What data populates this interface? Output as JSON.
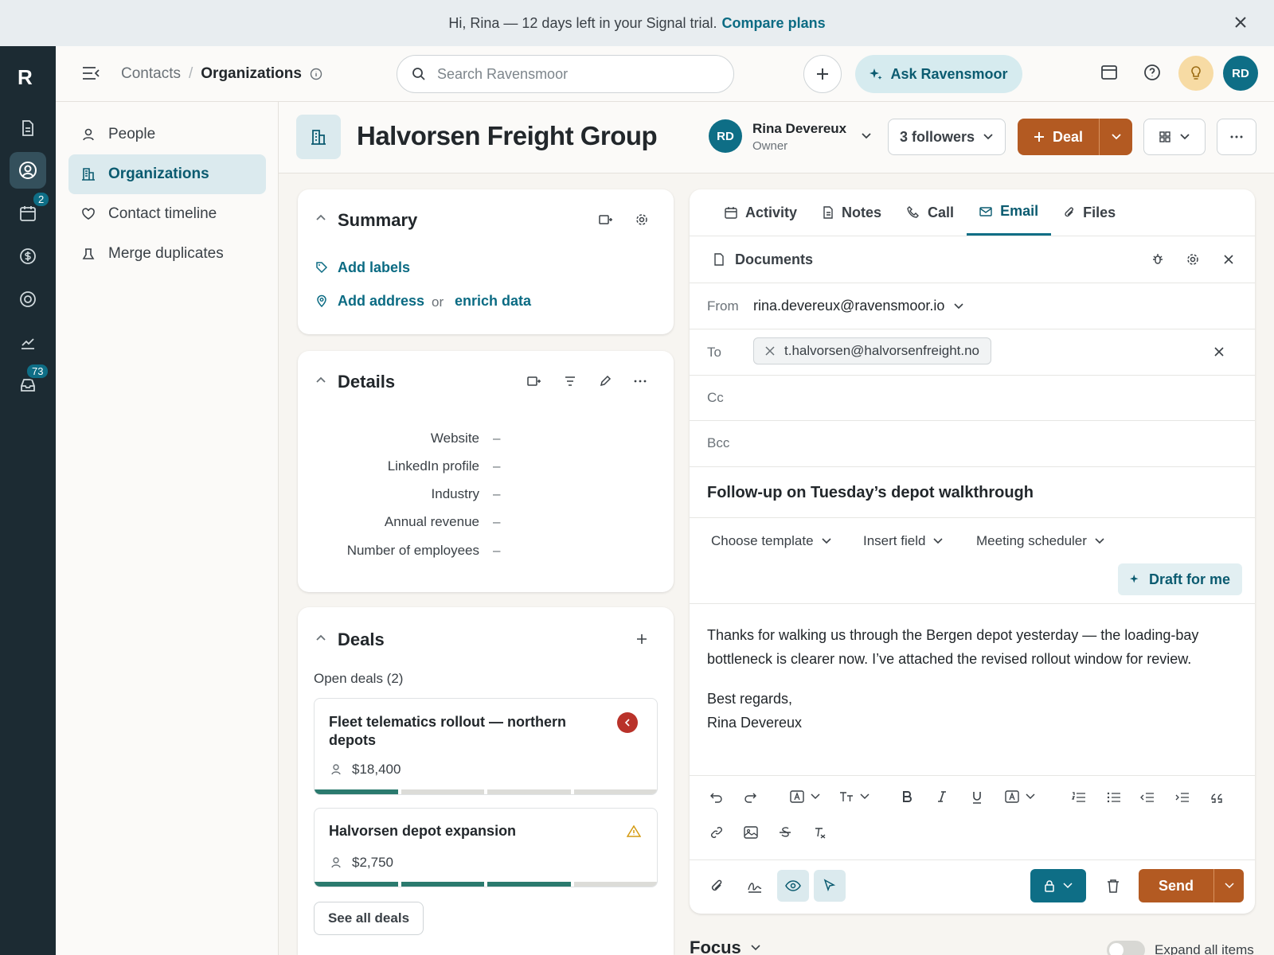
{
  "banner": {
    "text": "Hi, Rina — 12 days left in your Signal trial.",
    "link": "Compare plans"
  },
  "rail": {
    "logo": "R",
    "calendar_badge": "2",
    "inbox_badge": "73"
  },
  "topbar": {
    "breadcrumb_parent": "Contacts",
    "breadcrumb_separator": "/",
    "breadcrumb_current": "Organizations",
    "search_placeholder": "Search Ravensmoor",
    "ask_label": "Ask Ravensmoor",
    "user_initials": "RD"
  },
  "sidenav": {
    "items": [
      {
        "label": "People"
      },
      {
        "label": "Organizations"
      },
      {
        "label": "Contact timeline"
      },
      {
        "label": "Merge duplicates"
      }
    ]
  },
  "header": {
    "org_name": "Halvorsen Freight Group",
    "owner_initials": "RD",
    "owner_name": "Rina Devereux",
    "owner_role": "Owner",
    "followers": "3 followers",
    "deal_label": "Deal"
  },
  "summary": {
    "title": "Summary",
    "add_labels": "Add labels",
    "add_address": "Add address",
    "or": "or",
    "enrich": "enrich data"
  },
  "details": {
    "title": "Details",
    "fields": [
      {
        "label": "Website",
        "value": "–"
      },
      {
        "label": "LinkedIn profile",
        "value": "–"
      },
      {
        "label": "Industry",
        "value": "–"
      },
      {
        "label": "Annual revenue",
        "value": "–"
      },
      {
        "label": "Number of employees",
        "value": "–"
      }
    ]
  },
  "deals": {
    "title": "Deals",
    "open_label": "Open deals (2)",
    "items": [
      {
        "title": "Fleet telematics rollout — northern depots",
        "amount": "$18,400",
        "stages_done": 1,
        "stages_total": 4
      },
      {
        "title": "Halvorsen depot expansion",
        "amount": "$2,750",
        "stages_done": 3,
        "stages_total": 4
      }
    ],
    "see_all": "See all deals"
  },
  "email": {
    "tabs": [
      "Activity",
      "Notes",
      "Call",
      "Email",
      "Files"
    ],
    "active_tab": "Email",
    "documents": "Documents",
    "from_label": "From",
    "from_value": "rina.devereux@ravensmoor.io",
    "to_label": "To",
    "to_value": "t.halvorsen@halvorsenfreight.no",
    "cc_label": "Cc",
    "bcc_label": "Bcc",
    "subject": "Follow-up on Tuesday’s depot walkthrough",
    "choose_template": "Choose template",
    "insert_field": "Insert field",
    "meeting_scheduler": "Meeting scheduler",
    "draft_for_me": "Draft for me",
    "body_line1": "Thanks for walking us through the Bergen depot yesterday — the loading-bay",
    "body_line2": "bottleneck is clearer now. I’ve attached the revised rollout window for review.",
    "body_sign1": "Best regards,",
    "body_sign2": "Rina Devereux",
    "send_label": "Send"
  },
  "focus": {
    "title": "Focus",
    "expand": "Expand all items"
  }
}
